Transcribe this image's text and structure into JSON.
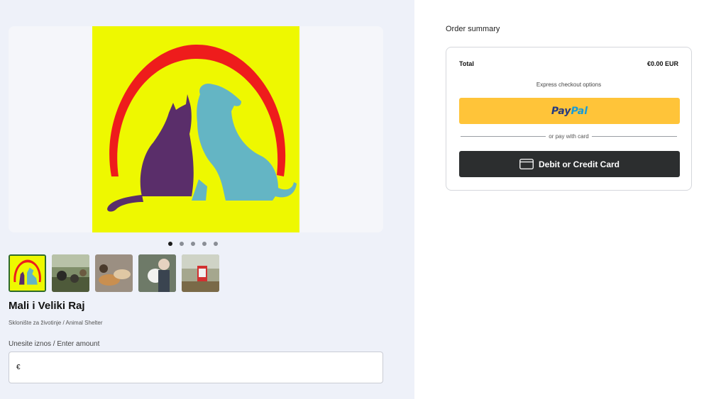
{
  "product": {
    "title": "Mali i Veliki Raj",
    "subtitle": "Sklonište za životinje / Animal Shelter",
    "images": [
      "shelter-logo",
      "dogs-outdoors",
      "dogs-lying",
      "woman-holding-dog",
      "shelter-sign"
    ],
    "active_image": 0,
    "carousel_dots": 5
  },
  "amount": {
    "label": "Unesite iznos / Enter amount",
    "currency_symbol": "€",
    "value": "",
    "placeholder": ""
  },
  "order_summary": {
    "heading": "Order summary",
    "total_label": "Total",
    "total_value": "€0.00 EUR",
    "express_label": "Express checkout options",
    "paypal_part1": "Pay",
    "paypal_part2": "Pal",
    "divider_text": "or pay with card",
    "card_button_label": "Debit or Credit Card"
  },
  "colors": {
    "paypal_button": "#ffc439",
    "card_button": "#2c2e2f",
    "logo_background": "#eef800",
    "logo_arc": "#ee1c1c",
    "logo_cat": "#5a2e6a",
    "logo_dog": "#64b5c4"
  }
}
